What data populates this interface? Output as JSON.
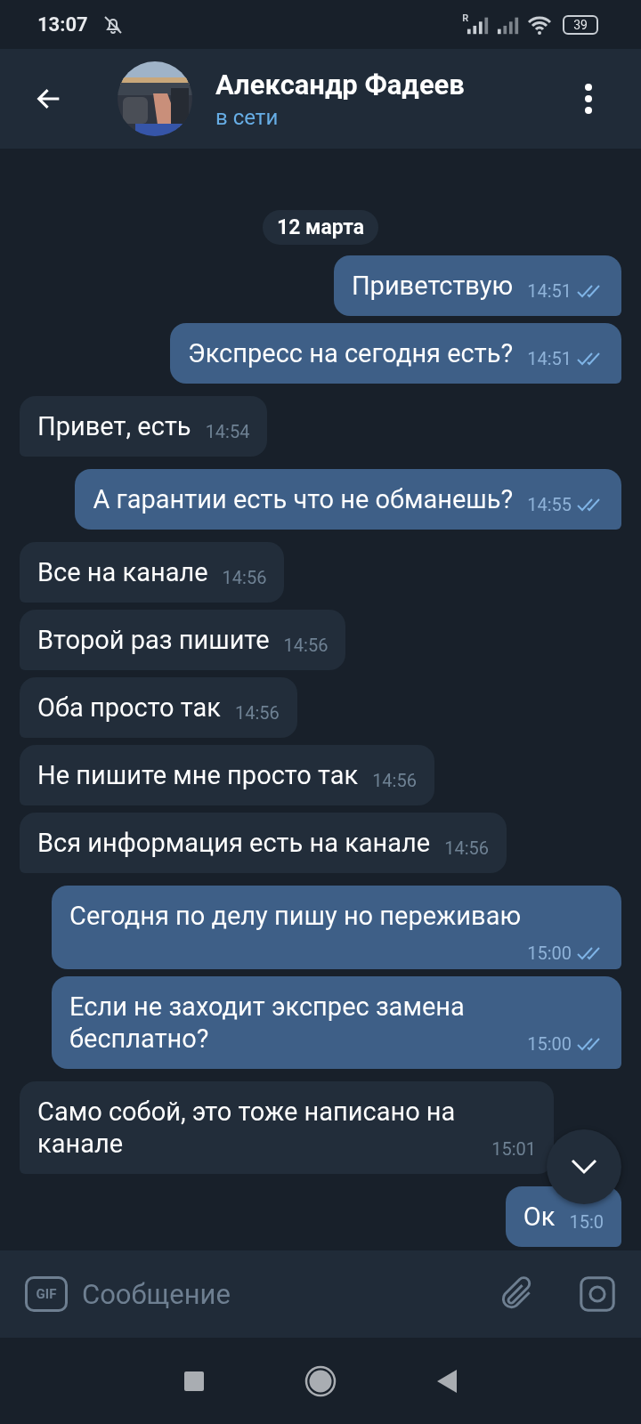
{
  "status_bar": {
    "time": "13:07",
    "roaming_mark": "R",
    "battery": "39"
  },
  "header": {
    "title": "Александр Фадеев",
    "status": "в сети"
  },
  "date_label": "12 марта",
  "messages": [
    {
      "kind": "out",
      "text": "Приветствую",
      "time": "14:51",
      "read": true
    },
    {
      "kind": "out",
      "text": "Экспресс на сегодня есть?",
      "time": "14:51",
      "read": true
    },
    {
      "kind": "in",
      "text": "Привет, есть",
      "time": "14:54"
    },
    {
      "kind": "out",
      "text": "А гарантии есть что не обманешь?",
      "time": "14:55",
      "read": true
    },
    {
      "kind": "in",
      "text": "Все на канале",
      "time": "14:56"
    },
    {
      "kind": "in",
      "text": "Второй раз пишите",
      "time": "14:56"
    },
    {
      "kind": "in",
      "text": "Оба просто так",
      "time": "14:56"
    },
    {
      "kind": "in",
      "text": "Не пишите мне просто так",
      "time": "14:56"
    },
    {
      "kind": "in",
      "text": "Вся информация есть на канале",
      "time": "14:56"
    },
    {
      "kind": "out",
      "text": "Сегодня по делу пишу но переживаю",
      "time": "15:00",
      "read": true
    },
    {
      "kind": "out",
      "text": "Если не заходит экспрес замена бесплатно?",
      "time": "15:00",
      "read": true
    },
    {
      "kind": "in",
      "text": "Само собой, это тоже написано на канале",
      "time": "15:01"
    },
    {
      "kind": "out",
      "text": "Ок",
      "time": "15:0"
    }
  ],
  "composer": {
    "gif_label": "GIF",
    "placeholder": "Сообщение"
  }
}
